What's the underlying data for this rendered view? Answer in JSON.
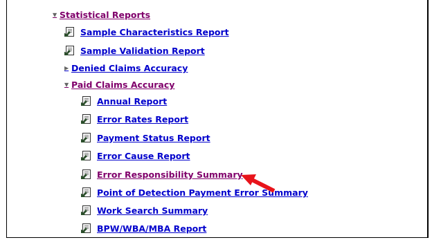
{
  "tree": {
    "statistical_reports": "Statistical Reports",
    "sample_characteristics": "Sample Characteristics Report",
    "sample_validation": "Sample Validation Report",
    "denied_claims": "Denied Claims Accuracy",
    "paid_claims": "Paid Claims Accuracy",
    "paid_items": [
      "Annual Report",
      "Error Rates Report",
      "Payment Status Report",
      "Error Cause Report",
      "Error Responsibility Summary",
      "Point of Detection Payment Error Summary",
      "Work Search Summary",
      "BPW/WBA/MBA Report"
    ]
  },
  "colors": {
    "link": "#0000cc",
    "visited": "#80006b",
    "arrow": "#e8141b"
  },
  "icons": {
    "expanded": "triangle-down-icon",
    "collapsed": "triangle-right-icon",
    "report": "report-document-icon"
  }
}
